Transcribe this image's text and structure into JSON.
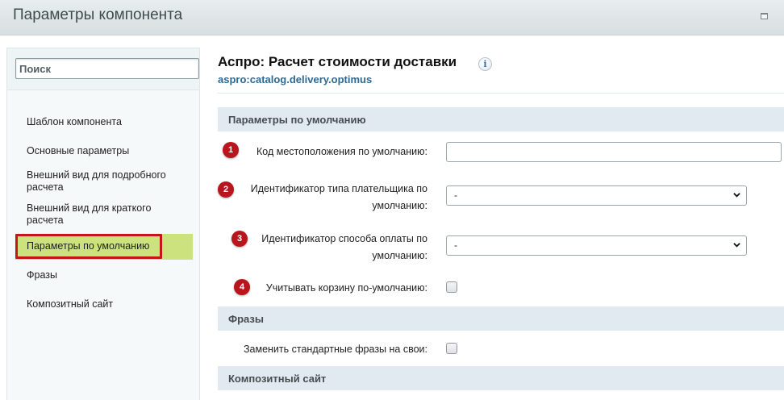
{
  "window": {
    "title": "Параметры компонента",
    "maximize_icon": "maximize-icon"
  },
  "sidebar": {
    "search_placeholder": "Поиск",
    "items": [
      {
        "label": "Шаблон компонента"
      },
      {
        "label": "Основные параметры"
      },
      {
        "label": "Внешний вид для подробного расчета"
      },
      {
        "label": "Внешний вид для краткого расчета"
      },
      {
        "label": "Параметры по умолчанию",
        "active": true
      },
      {
        "label": "Фразы"
      },
      {
        "label": "Композитный сайт"
      }
    ]
  },
  "main": {
    "title": "Аспро: Расчет стоимости доставки",
    "subtitle": "aspro:catalog.delivery.optimus",
    "info_icon": "i",
    "sections": [
      {
        "title": "Параметры по умолчанию",
        "fields": [
          {
            "badge": "1",
            "label": "Код местоположения по умолчанию:",
            "type": "text",
            "value": ""
          },
          {
            "badge": "2",
            "label_line1": "Идентификатор типа плательщика по",
            "label_line2": "умолчанию:",
            "type": "select",
            "value": "-"
          },
          {
            "badge": "3",
            "label_line1": "Идентификатор способа оплаты по",
            "label_line2": "умолчанию:",
            "type": "select",
            "value": "-"
          },
          {
            "badge": "4",
            "label": "Учитывать корзину по-умолчанию:",
            "type": "checkbox",
            "checked": false
          }
        ]
      },
      {
        "title": "Фразы",
        "fields": [
          {
            "label": "Заменить стандартные фразы на свои:",
            "type": "checkbox",
            "checked": false
          }
        ]
      },
      {
        "title": "Композитный сайт",
        "fields": []
      }
    ]
  },
  "colors": {
    "active_nav_bg": "#cbe27e",
    "highlight_border": "#c4151c",
    "badge_bg": "#b8151c",
    "section_bg": "#e1eaf0",
    "subtitle_link": "#2f6890"
  }
}
